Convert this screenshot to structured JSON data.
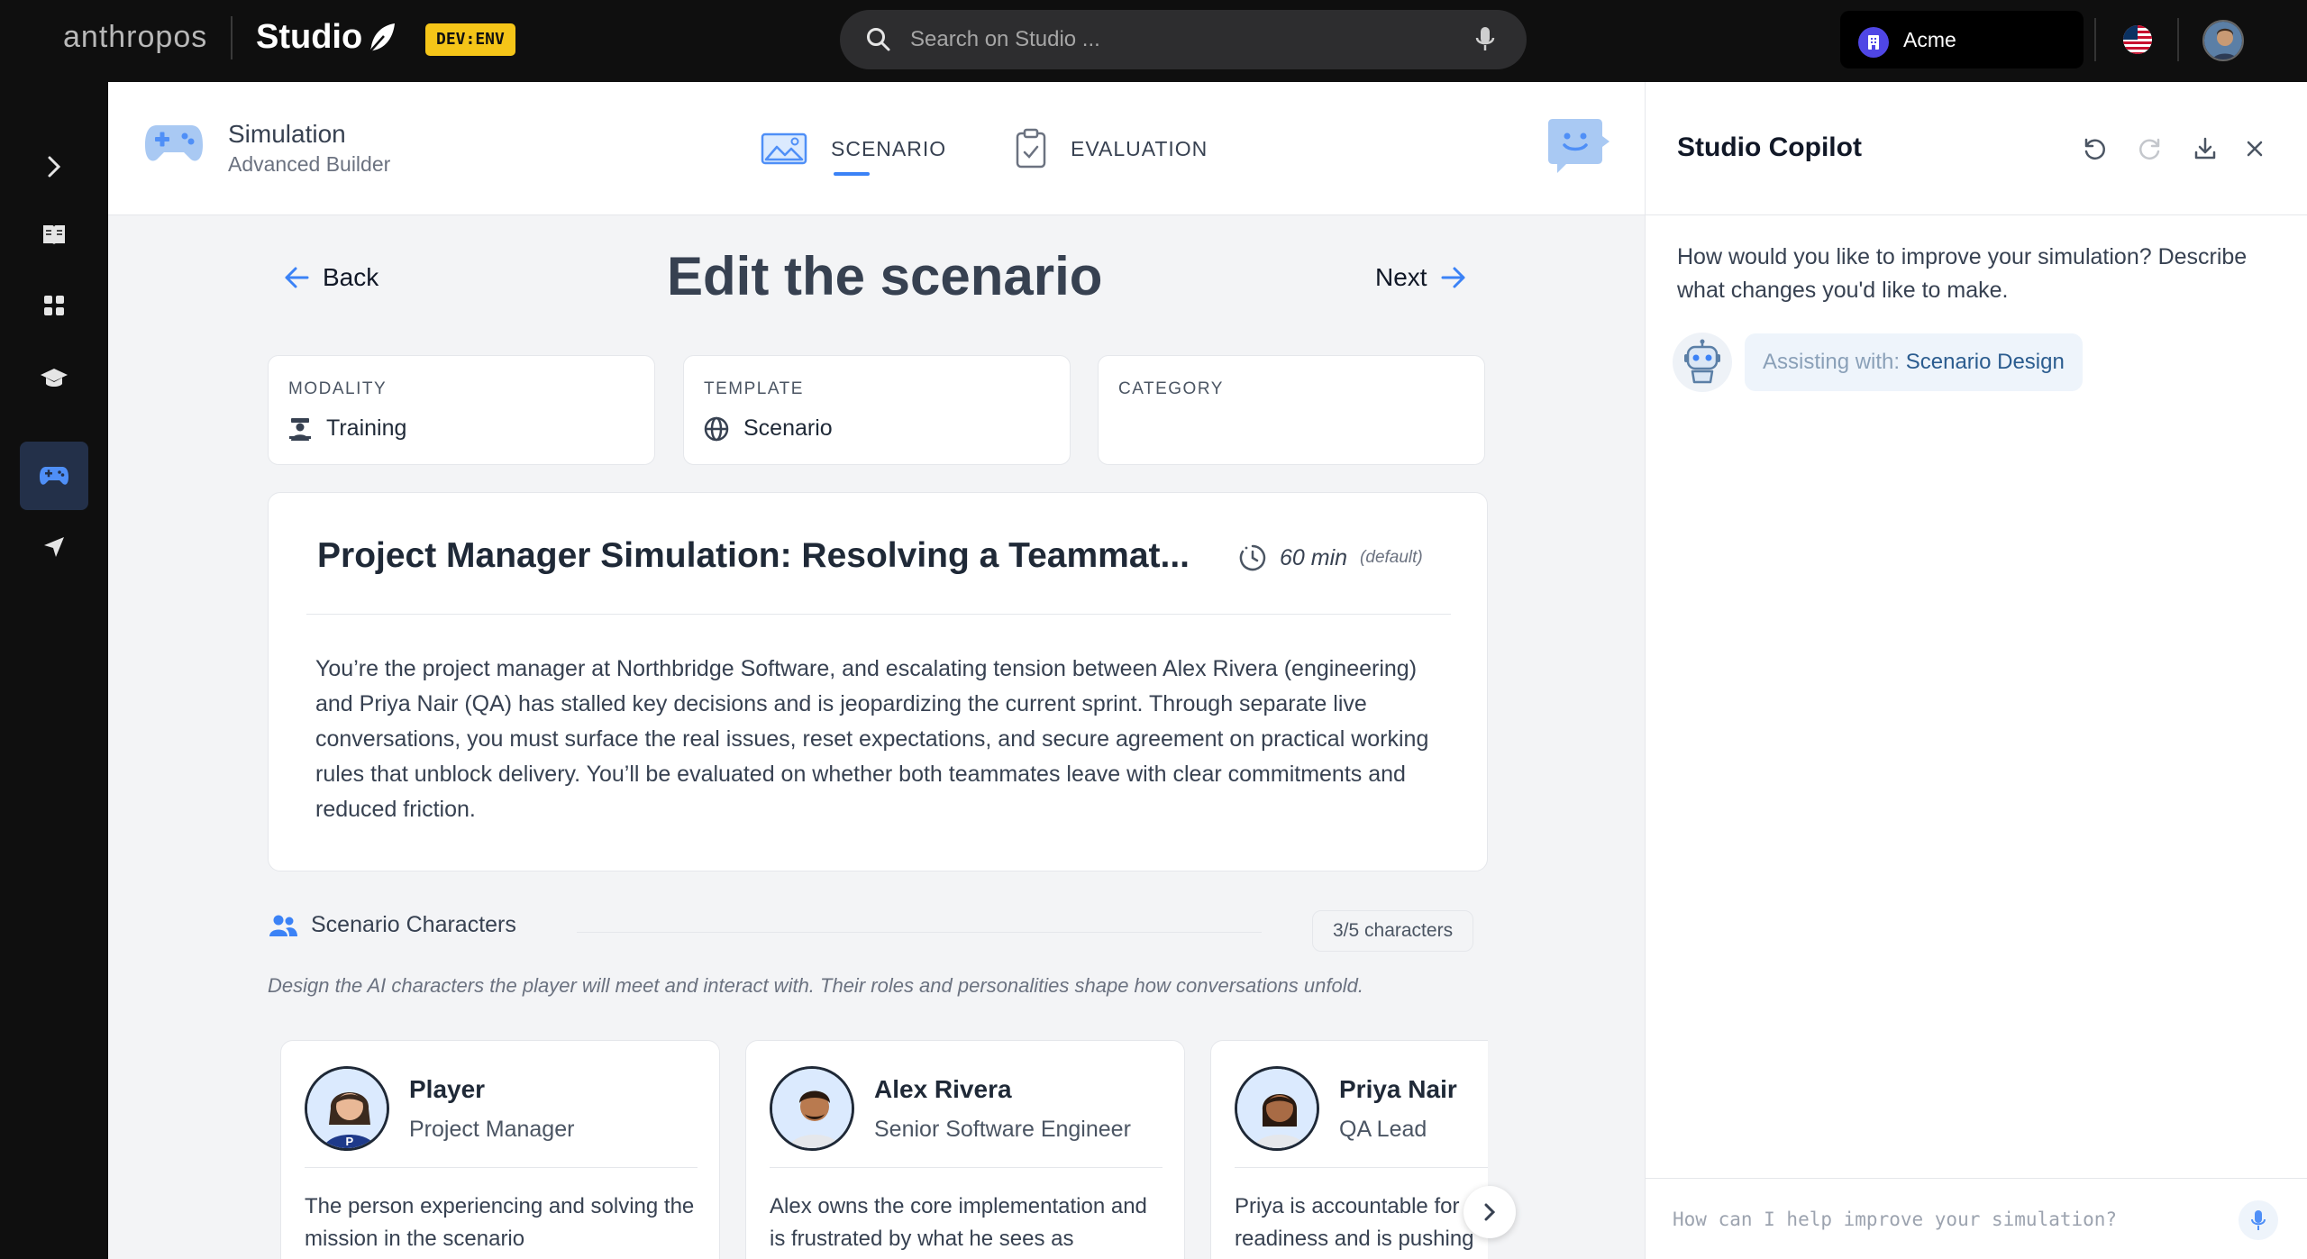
{
  "topbar": {
    "brand": "anthropos",
    "app_name": "Studio",
    "env_badge": "DEV:ENV",
    "search_placeholder": "Search on Studio ...",
    "org_name": "Acme",
    "icons": [
      "feather-icon",
      "search-icon",
      "microphone-icon",
      "organization-icon",
      "us-flag-icon",
      "user-avatar"
    ]
  },
  "rail": {
    "items": [
      "expand-chevron-icon",
      "book-icon",
      "grid-icon",
      "graduation-cap-icon",
      "gamepad-icon",
      "send-icon"
    ],
    "active": "gamepad-icon"
  },
  "header": {
    "title": "Simulation",
    "subtitle": "Advanced Builder",
    "tabs": [
      {
        "label": "SCENARIO",
        "active": true
      },
      {
        "label": "EVALUATION",
        "active": false
      }
    ]
  },
  "editor": {
    "back_label": "Back",
    "title": "Edit the scenario",
    "next_label": "Next",
    "meta": {
      "modality": {
        "label": "MODALITY",
        "value": "Training"
      },
      "template": {
        "label": "TEMPLATE",
        "value": "Scenario"
      },
      "category": {
        "label": "CATEGORY",
        "value": ""
      }
    },
    "scenario": {
      "title": "Project Manager Simulation: Resolving a Teammat...",
      "duration": "60 min",
      "duration_note": "(default)",
      "description": "You’re the project manager at Northbridge Software, and escalating tension between Alex Rivera (engineering) and Priya Nair (QA) has stalled key decisions and is jeopardizing the current sprint. Through separate live conversations, you must surface the real issues, reset expectations, and secure agreement on practical working rules that unblock delivery. You’ll be evaluated on whether both teammates leave with clear commitments and reduced friction."
    },
    "characters": {
      "heading": "Scenario Characters",
      "count": "3/5 characters",
      "subtitle": "Design the AI characters the player will meet and interact with. Their roles and personalities shape how conversations unfold.",
      "items": [
        {
          "name": "Player",
          "role": "Project Manager",
          "desc": "The person experiencing and solving the mission in the scenario"
        },
        {
          "name": "Alex Rivera",
          "role": "Senior Software Engineer",
          "desc": "Alex owns the core implementation and is frustrated by what he sees as"
        },
        {
          "name": "Priya Nair",
          "role": "QA Lead",
          "desc": "Priya is accountable for release readiness and is pushing"
        }
      ]
    }
  },
  "copilot": {
    "title": "Studio Copilot",
    "message": "How would you like to improve your simulation? Describe what changes you'd like to make.",
    "chip_label": "Assisting with:",
    "chip_value": "Scenario Design",
    "input_placeholder": "How can I help improve your simulation?"
  },
  "colors": {
    "accent": "#3b82f6",
    "topbar_bg": "#0f0f0f",
    "badge_yellow": "#f5c518",
    "rail_active": "#233049"
  }
}
